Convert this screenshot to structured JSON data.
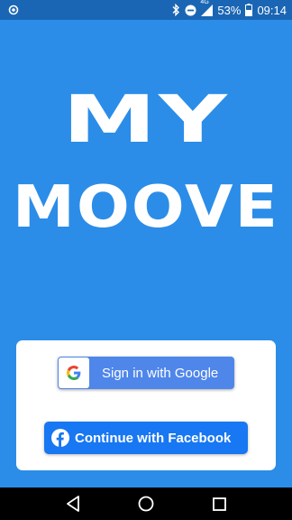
{
  "status_bar": {
    "network_label": "4G",
    "battery_percent": "53%",
    "time": "09:14",
    "icons": [
      "notification-dot-icon",
      "bluetooth-icon",
      "do-not-disturb-icon",
      "signal-icon",
      "battery-icon"
    ]
  },
  "logo": {
    "line1": "MY",
    "line2": "MOOVE"
  },
  "auth": {
    "google_label": "Sign in with Google",
    "facebook_label": "Continue with Facebook"
  },
  "colors": {
    "background": "#2B8DE8",
    "status_bar": "#1A66B4",
    "google_button": "#4F86EA",
    "facebook_button": "#1877F2"
  },
  "nav_bar": {
    "icons": [
      "back-icon",
      "home-icon",
      "recents-icon"
    ]
  }
}
